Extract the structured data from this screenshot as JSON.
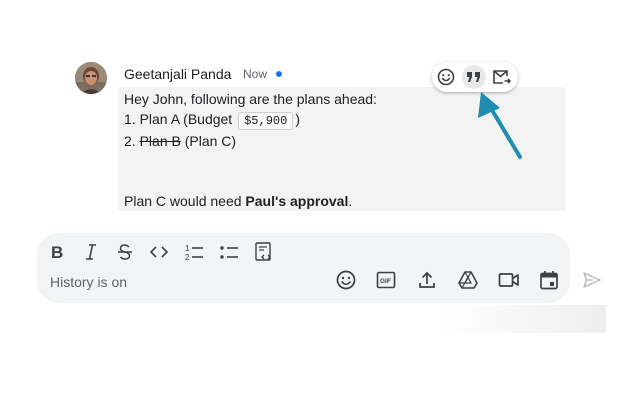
{
  "message": {
    "sender": "Geetanjali Panda",
    "time": "Now",
    "greeting": "Hey John, following are the plans ahead:",
    "item1_prefix": "1.  Plan A (Budget",
    "item1_code": "$5,900",
    "item1_suffix": ")",
    "item2_prefix": "2.",
    "item2_struck": "Plan B",
    "item2_suffix": "(Plan C)",
    "closing_prefix": "Plan C would need ",
    "closing_bold": "Paul's approval",
    "closing_suffix": "."
  },
  "hover_actions": {
    "icons": [
      "add-reaction-icon",
      "quote-reply-icon",
      "forward-to-inbox-icon"
    ]
  },
  "composer": {
    "placeholder": "History is on",
    "format_icons": [
      "bold-icon",
      "italic-icon",
      "strikethrough-icon",
      "code-icon",
      "numbered-list-icon",
      "bulleted-list-icon",
      "code-block-icon"
    ],
    "action_icons": [
      "emoji-icon",
      "gif-icon",
      "upload-icon",
      "drive-icon",
      "video-meeting-icon",
      "calendar-icon",
      "send-icon"
    ]
  },
  "colors": {
    "accent": "#1a73e8",
    "arrow": "#1f8db0",
    "message_bg": "#f3f3f3",
    "composer_bg": "#f1f3f4"
  }
}
